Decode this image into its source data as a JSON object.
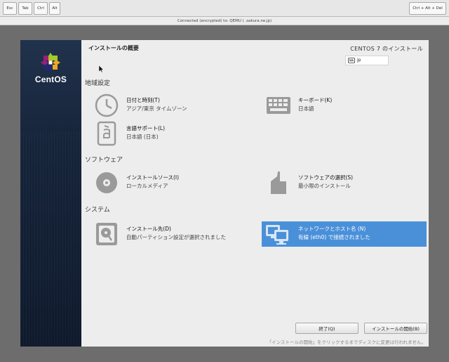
{
  "toolbar": {
    "keys": [
      "Esc",
      "Tab",
      "Ctrl",
      "Alt"
    ],
    "cad_label": "Ctrl + Alt + Del"
  },
  "status": {
    "connection": "Connected (encrypted) to: QEMU (                    .sakura.ne.jp)"
  },
  "sidebar": {
    "brand": "CentOS"
  },
  "header": {
    "title": "インストールの概要",
    "product": "CENTOS 7 のインストール",
    "keyboard_layout": "jp"
  },
  "sections": {
    "localization": {
      "title": "地域設定",
      "datetime": {
        "title": "日付と時刻(T)",
        "status": "アジア/東京 タイムゾーン"
      },
      "keyboard": {
        "title": "キーボード(K)",
        "status": "日本語"
      },
      "language": {
        "title": "言語サポート(L)",
        "status": "日本語 (日本)"
      }
    },
    "software": {
      "title": "ソフトウェア",
      "source": {
        "title": "インストールソース(I)",
        "status": "ローカルメディア"
      },
      "selection": {
        "title": "ソフトウェアの選択(S)",
        "status": "最小限のインストール"
      }
    },
    "system": {
      "title": "システム",
      "destination": {
        "title": "インストール先(D)",
        "status": "自動パーティション設定が選択されました"
      },
      "network": {
        "title": "ネットワークとホスト名 (N)",
        "status": "有線 (eth0) で接続されました"
      }
    }
  },
  "footer": {
    "quit_label": "終了(Q)",
    "begin_label": "インストールの開始(B)",
    "note": "「インストールの開始」をクリックするまでディスクに変更は行われません。"
  },
  "colors": {
    "accent": "#4a90d9",
    "sidebar": "#16243a",
    "background": "#ededed"
  }
}
